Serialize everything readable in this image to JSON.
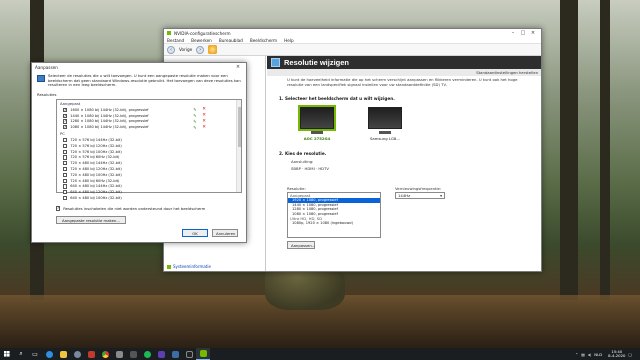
{
  "nvidia": {
    "title": "NVIDIA-configuratiescherm",
    "menu": [
      "Bestand",
      "Bewerken",
      "Bureaublad",
      "Beeldscherm",
      "Help"
    ],
    "toolbar": {
      "back": "Vorige"
    },
    "page_title": "Resolutie wijzigen",
    "restore_defaults": "Standaardinstellingen herstellen",
    "description": "U kunt de hoeveelheid informatie die op het scherm verschijnt aanpassen en flikkeren verminderen. U kunt ook het hoge resolutie van een landspecifiek signaal instellen voor uw standaarddefinitie (SD) TV.",
    "step1": "1. Selecteer het beeldscherm dat u wilt wijzigen.",
    "monitors": [
      {
        "label": "AOC 2752G4",
        "selected": true
      },
      {
        "label": "Samsung LG8...",
        "selected": false
      }
    ],
    "step2": "2. Kies de resolutie.",
    "connection_label": "Aansluiting:",
    "connection_value": "SBBP · HDMI · HDTV",
    "resolution_label": "Resolutie:",
    "resolution_list": {
      "group1": "Aangepast",
      "items1": [
        {
          "label": "1920 × 1080, progressief",
          "selected": true
        },
        {
          "label": "1440 × 1080, progressief",
          "selected": false
        },
        {
          "label": "1280 × 1080, progressief",
          "selected": false
        },
        {
          "label": "1080 × 1080, progressief",
          "selected": false
        }
      ],
      "group2": "Ultra HD, HD, SD",
      "items2": [
        {
          "label": "1080p, 1920 × 1080 (ingebouwd)",
          "selected": false
        }
      ]
    },
    "refresh_label": "Vernieuwingsfrequentie:",
    "refresh_value": "144Hz",
    "customize_button": "Aanpassen...",
    "footer_link": "Systeeminformatie"
  },
  "dialog": {
    "title": "Aanpassen",
    "intro": "Selecteer de resoluties die u wilt toevoegen. U kunt een aangepaste resolutie maken voor een beeldscherm dat geen standaard Windows-resolutie gebruikt. Het toevoegen van deze resoluties kan resulteren in een leeg beeldscherm.",
    "resolutions_label": "Resoluties",
    "group_custom": "Aangepast",
    "custom_rows": [
      {
        "label": "1600 × 1080 bij 144Hz (32-bit), progressief",
        "checked": true
      },
      {
        "label": "1440 × 1080 bij 144Hz (32-bit), progressief",
        "checked": true
      },
      {
        "label": "1280 × 1080 bij 144Hz (32-bit), progressief",
        "checked": true
      },
      {
        "label": "1080 × 1080 bij 144Hz (32-bit), progressief",
        "checked": true
      }
    ],
    "group_pc": "PC",
    "pc_rows": [
      {
        "label": "720 × 576 bij 144Hz (32-bit)",
        "checked": false
      },
      {
        "label": "720 × 576 bij 120Hz (32-bit)",
        "checked": false
      },
      {
        "label": "720 × 576 bij 100Hz (32-bit)",
        "checked": false
      },
      {
        "label": "720 × 576 bij 60Hz (32-bit)",
        "checked": false
      },
      {
        "label": "720 × 480 bij 144Hz (32-bit)",
        "checked": false
      },
      {
        "label": "720 × 480 bij 120Hz (32-bit)",
        "checked": false
      },
      {
        "label": "720 × 480 bij 100Hz (32-bit)",
        "checked": false
      },
      {
        "label": "720 × 480 bij 60Hz (32-bit)",
        "checked": false
      },
      {
        "label": "640 × 480 bij 144Hz (32-bit)",
        "checked": false
      },
      {
        "label": "640 × 480 bij 120Hz (32-bit)",
        "checked": false
      },
      {
        "label": "640 × 480 bij 100Hz (32-bit)",
        "checked": false
      }
    ],
    "enable_unsupported": "Resoluties inschakelen die niet worden ondersteund door het beeldscherm",
    "create_custom": "Aangepaste resolutie maken...",
    "ok": "OK",
    "cancel": "Annuleren"
  },
  "taskbar": {
    "language": "NLD",
    "time": "15:40",
    "date": "8-4-2020"
  }
}
